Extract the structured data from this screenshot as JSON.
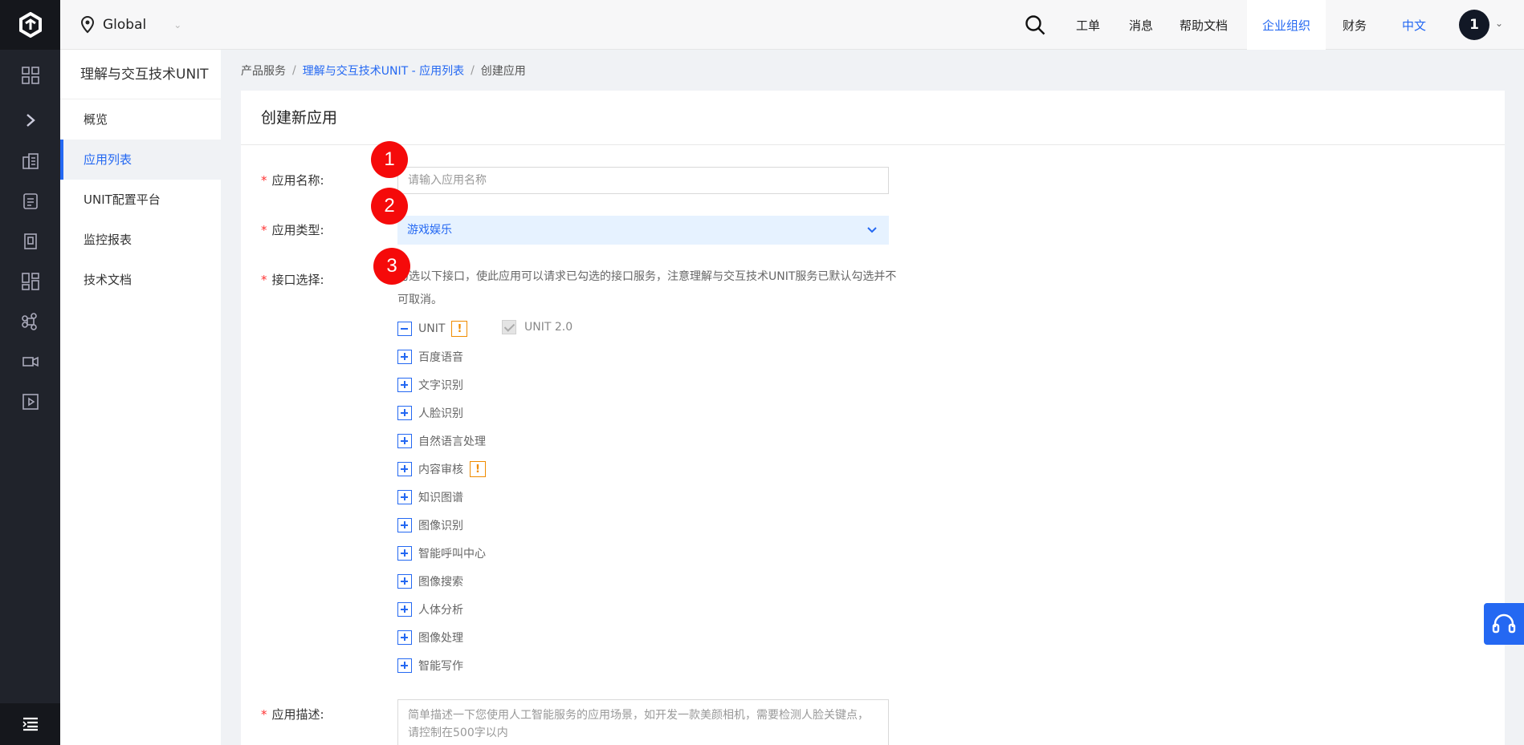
{
  "topbar": {
    "region": "Global",
    "nav": [
      "工单",
      "消息",
      "帮助文档",
      "企业组织",
      "财务",
      "中文"
    ],
    "avatar": "1"
  },
  "sidenav": {
    "title": "理解与交互技术UNIT",
    "items": [
      "概览",
      "应用列表",
      "UNIT配置平台",
      "监控报表",
      "技术文档"
    ]
  },
  "breadcrumb": [
    "产品服务",
    "理解与交互技术UNIT - 应用列表",
    "创建应用"
  ],
  "form": {
    "title": "创建新应用",
    "name_label": "应用名称:",
    "name_placeholder": "请输入应用名称",
    "type_label": "应用类型:",
    "type_value": "游戏娱乐",
    "api_label": "接口选择:",
    "api_hint": "勾选以下接口，使此应用可以请求已勾选的接口服务，注意理解与交互技术UNIT服务已默认勾选并不可取消。",
    "apis": [
      "UNIT",
      "百度语音",
      "文字识别",
      "人脸识别",
      "自然语言处理",
      "内容审核",
      "知识图谱",
      "图像识别",
      "智能呼叫中心",
      "图像搜索",
      "人体分析",
      "图像处理",
      "智能写作"
    ],
    "unit_sub": "UNIT 2.0",
    "warn_mark": "!",
    "desc_label": "应用描述:",
    "desc_placeholder": "简单描述一下您使用人工智能服务的应用场景，如开发一款美颜相机，需要检测人脸关键点，请控制在500字以内"
  },
  "markers": [
    "1",
    "2",
    "3"
  ],
  "colors": {
    "accent": "#2468f2",
    "rail": "#20232b",
    "marker": "#f50a0a",
    "warning": "#f08c00"
  }
}
